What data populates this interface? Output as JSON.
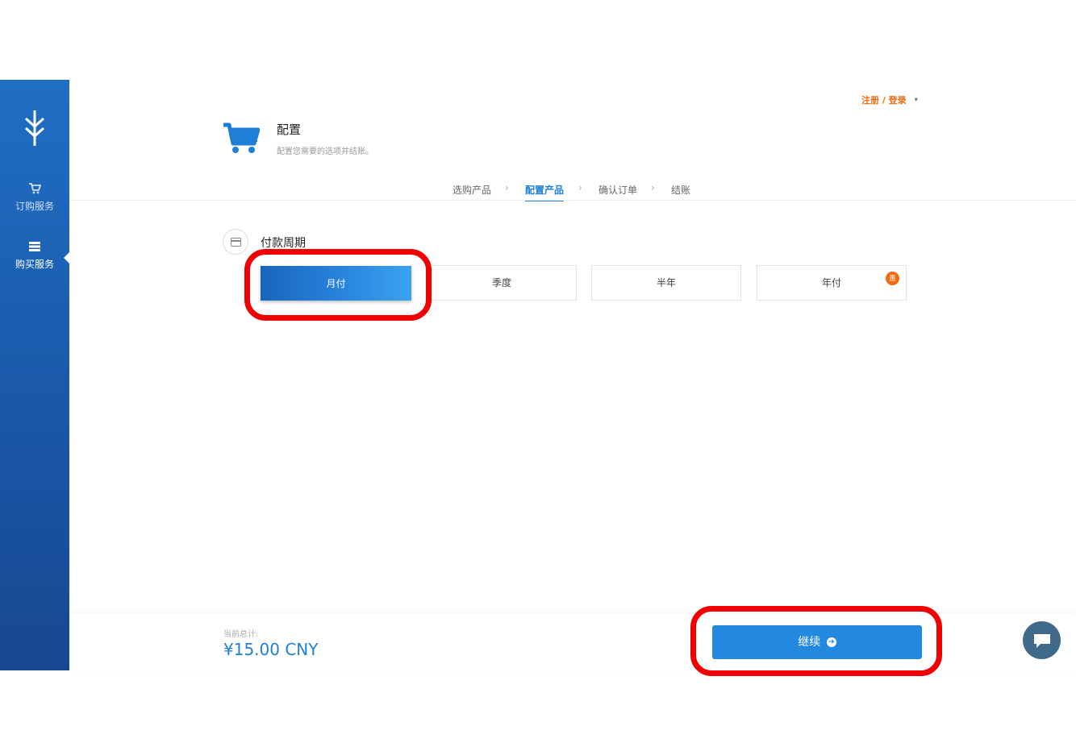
{
  "sidebar": {
    "items": [
      {
        "label": "订购服务",
        "icon": "cart-icon"
      },
      {
        "label": "购买服务",
        "icon": "list-icon"
      }
    ]
  },
  "header": {
    "login_label": "注册 / 登录",
    "caret": "▾",
    "title": "配置",
    "subtitle": "配置您需要的选项并结账。"
  },
  "steps": [
    {
      "label": "选购产品",
      "active": false
    },
    {
      "label": "配置产品",
      "active": true
    },
    {
      "label": "确认订单",
      "active": false
    },
    {
      "label": "结账",
      "active": false
    }
  ],
  "billing": {
    "title": "付款周期",
    "options": [
      {
        "label": "月付",
        "selected": true
      },
      {
        "label": "季度",
        "selected": false
      },
      {
        "label": "半年",
        "selected": false
      },
      {
        "label": "年付",
        "selected": false,
        "badge": "惠"
      }
    ]
  },
  "footer": {
    "total_label": "当前总计:",
    "total_value": "¥15.00 CNY",
    "continue_label": "继续",
    "continue_icon": "arrow-circle-right-icon"
  },
  "colors": {
    "accent": "#1e7fd8",
    "sidebar": "#1a56a6",
    "login": "#f26a10",
    "highlight": "#f00000"
  }
}
